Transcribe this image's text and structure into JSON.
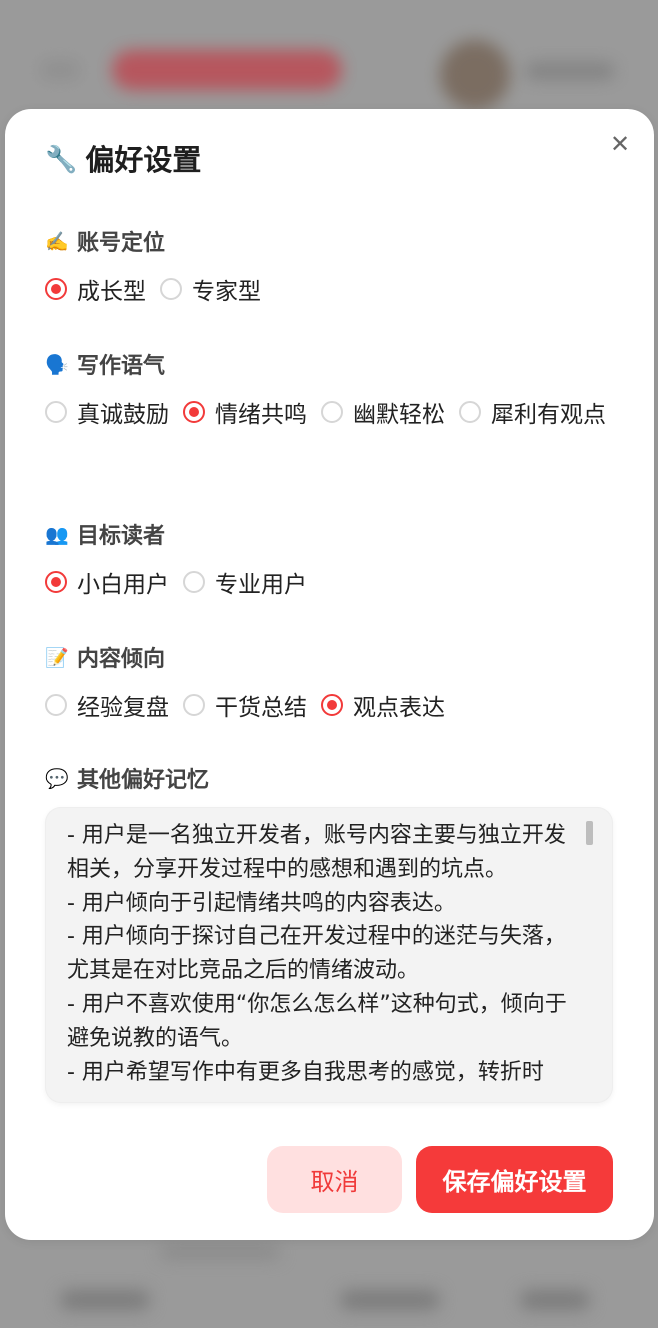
{
  "modal": {
    "title_emoji": "🔧",
    "title": "偏好设置",
    "close_icon": "✕"
  },
  "sections": [
    {
      "emoji": "✍️",
      "label": "账号定位",
      "options": [
        {
          "label": "成长型",
          "checked": true
        },
        {
          "label": "专家型",
          "checked": false
        }
      ]
    },
    {
      "emoji": "🗣️",
      "label": "写作语气",
      "options": [
        {
          "label": "真诚鼓励",
          "checked": false
        },
        {
          "label": "情绪共鸣",
          "checked": true
        },
        {
          "label": "幽默轻松",
          "checked": false
        },
        {
          "label": "犀利有观点",
          "checked": false
        }
      ]
    },
    {
      "emoji": "👥",
      "label": "目标读者",
      "options": [
        {
          "label": "小白用户",
          "checked": true
        },
        {
          "label": "专业用户",
          "checked": false
        }
      ]
    },
    {
      "emoji": "📝",
      "label": "内容倾向",
      "options": [
        {
          "label": "经验复盘",
          "checked": false
        },
        {
          "label": "干货总结",
          "checked": false
        },
        {
          "label": "观点表达",
          "checked": true
        }
      ]
    }
  ],
  "memory": {
    "emoji": "💬",
    "label": "其他偏好记忆",
    "text": "- 用户是一名独立开发者，账号内容主要与独立开发相关，分享开发过程中的感想和遇到的坑点。\n- 用户倾向于引起情绪共鸣的内容表达。\n- 用户倾向于探讨自己在开发过程中的迷茫与失落，尤其是在对比竞品之后的情绪波动。\n- 用户不喜欢使用“你怎么怎么样”这种句式，倾向于避免说教的语气。\n- 用户希望写作中有更多自我思考的感觉，转折时"
  },
  "buttons": {
    "cancel": "取消",
    "save": "保存偏好设置"
  },
  "colors": {
    "accent": "#f23a3a",
    "cancel_bg": "#ffe0e0",
    "overlay": "#9a9a9a"
  }
}
